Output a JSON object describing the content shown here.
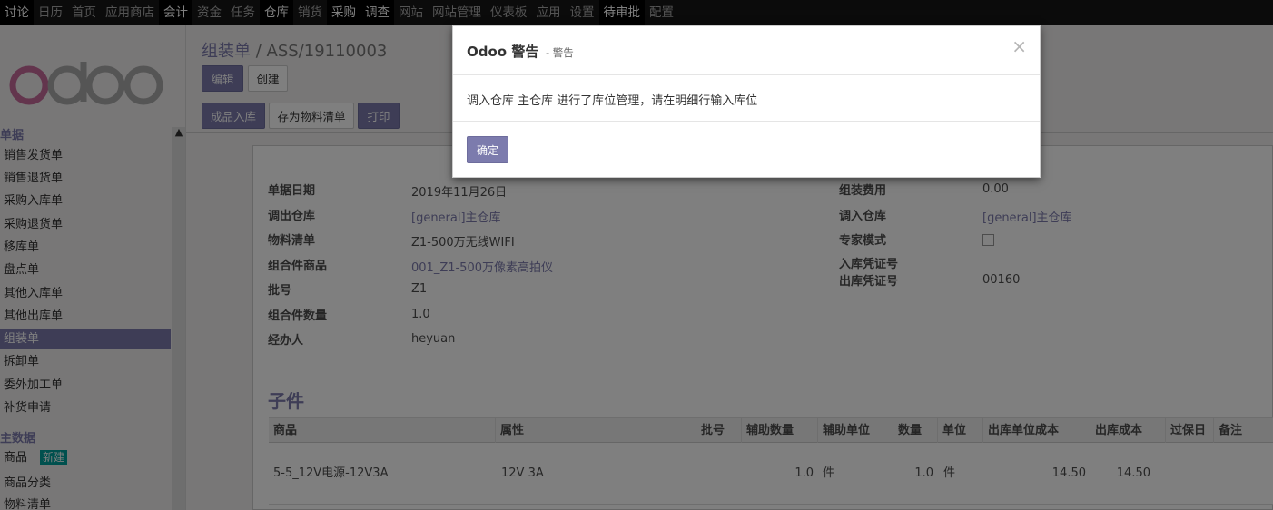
{
  "topmenu": {
    "items": [
      {
        "label": "讨论",
        "state": "hl"
      },
      {
        "label": "日历",
        "state": "dim"
      },
      {
        "label": "首页",
        "state": "dim"
      },
      {
        "label": "应用商店",
        "state": "dim"
      },
      {
        "label": "会计",
        "state": "hl"
      },
      {
        "label": "资金",
        "state": "dim"
      },
      {
        "label": "任务",
        "state": "dim"
      },
      {
        "label": "仓库",
        "state": "hl"
      },
      {
        "label": "销货",
        "state": "dim"
      },
      {
        "label": "采购",
        "state": "hl"
      },
      {
        "label": "调查",
        "state": "hl"
      },
      {
        "label": "网站",
        "state": "dim"
      },
      {
        "label": "网站管理",
        "state": "dim"
      },
      {
        "label": "仪表板",
        "state": "dim"
      },
      {
        "label": "应用",
        "state": "dim"
      },
      {
        "label": "设置",
        "state": "dim"
      },
      {
        "label": "待审批",
        "state": "hl"
      },
      {
        "label": "配置",
        "state": "dim"
      }
    ]
  },
  "sidebar": {
    "logo_text": "odoo",
    "section1": "单据",
    "items": [
      "销售发货单",
      "销售退货单",
      "采购入库单",
      "采购退货单",
      "移库单",
      "盘点单",
      "其他入库单",
      "其他出库单",
      "组装单",
      "拆卸单",
      "委外加工单",
      "补货申请"
    ],
    "section2": "主数据",
    "items2": [
      "商品",
      "商品分类",
      "物料清单"
    ],
    "new_badge": "新建"
  },
  "breadcrumb": {
    "parent": "组装单",
    "separator": " / ",
    "current": "ASS/19110003"
  },
  "buttons": {
    "edit": "编辑",
    "create": "创建",
    "finish_in": "成品入库",
    "save_bom": "存为物料清单",
    "print": "打印"
  },
  "form": {
    "left": {
      "date_label": "单据日期",
      "date_value": "2019年11月26日",
      "out_wh_label": "调出仓库",
      "out_wh_value": "[general]主仓库",
      "bom_label": "物料清单",
      "bom_value": "Z1-500万无线WIFI",
      "product_label": "组合件商品",
      "product_value": "001_Z1-500万像素高拍仪",
      "lot_label": "批号",
      "lot_value": "Z1",
      "qty_label": "组合件数量",
      "qty_value": "1.0",
      "user_label": "经办人",
      "user_value": "heyuan"
    },
    "right": {
      "fee_label": "组装费用",
      "fee_value": "0.00",
      "in_wh_label": "调入仓库",
      "in_wh_value": "[general]主仓库",
      "expert_label": "专家模式",
      "in_voucher_label": "入库凭证号",
      "out_voucher_label": "出库凭证号",
      "out_voucher_value": "00160"
    }
  },
  "components": {
    "title": "子件",
    "columns": [
      "商品",
      "属性",
      "批号",
      "辅助数量",
      "辅助单位",
      "数量",
      "单位",
      "出库单位成本",
      "出库成本",
      "过保日",
      "备注"
    ],
    "rows": [
      {
        "product": "5-5_12V电源-12V3A",
        "attribute": "12V 3A",
        "lot": "",
        "aux_qty": "1.0",
        "aux_unit": "件",
        "qty": "1.0",
        "unit": "件",
        "unit_cost": "14.50",
        "cost": "14.50",
        "expiry": "",
        "note": ""
      }
    ]
  },
  "dialog": {
    "title": "Odoo 警告",
    "subtitle": "- 警告",
    "close": "×",
    "message": "调入仓库 主仓库 进行了库位管理，请在明细行输入库位",
    "ok": "确定"
  }
}
